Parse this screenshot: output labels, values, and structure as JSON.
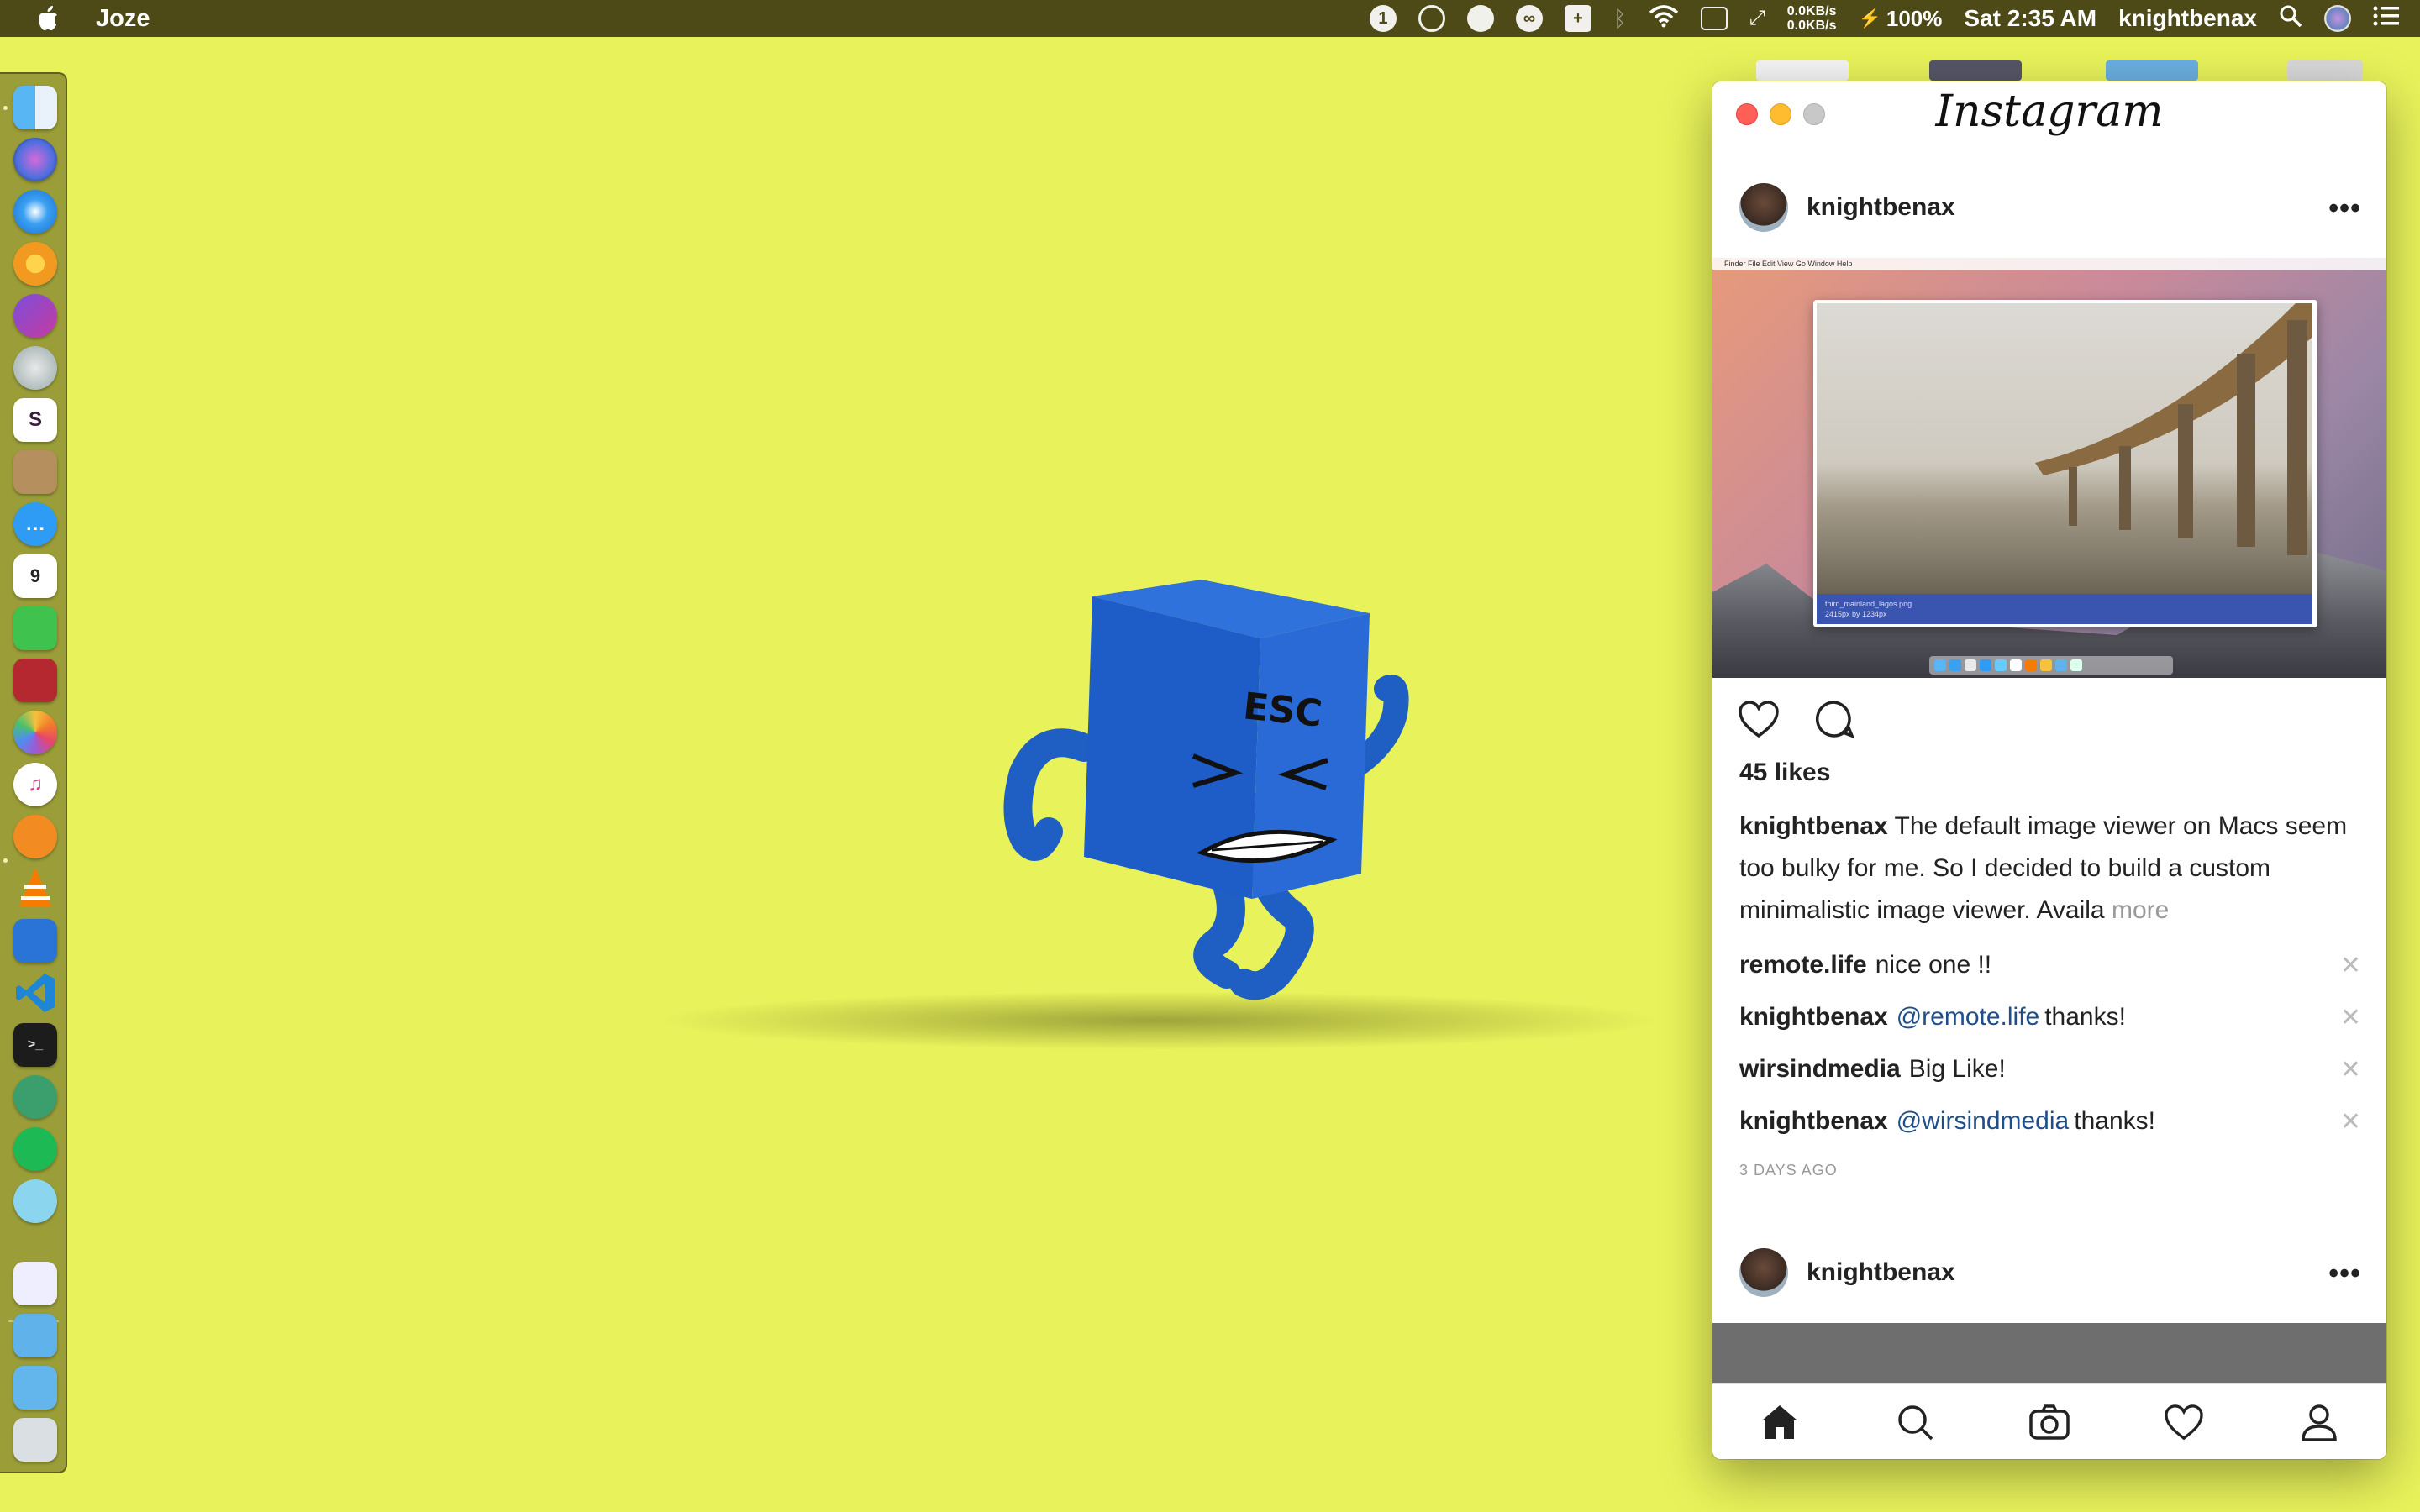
{
  "menubar": {
    "app_name": "Joze",
    "net_up": "0.0KB/s",
    "net_down": "0.0KB/s",
    "battery": "100%",
    "clock": "Sat 2:35 AM",
    "user": "knightbenax"
  },
  "instagram": {
    "logo": "Instagram",
    "post": {
      "username": "knightbenax",
      "more_label": "•••",
      "screenshot": {
        "menu": "Finder   File   Edit   View   Go   Window   Help",
        "info_line1": "third_mainland_lagos.png",
        "info_line2": "2415px by 1234px"
      },
      "likes": "45 likes",
      "caption_user": "knightbenax",
      "caption_text": "The default image viewer on Macs seem too bulky for me. So I decided to build a custom minimalistic image viewer. Availa",
      "caption_more": "more",
      "comments": [
        {
          "user": "remote.life",
          "mention": "",
          "text": "nice one !!"
        },
        {
          "user": "knightbenax",
          "mention": "@remote.life",
          "text": "thanks!"
        },
        {
          "user": "wirsindmedia",
          "mention": "",
          "text": "Big Like!"
        },
        {
          "user": "knightbenax",
          "mention": "@wirsindmedia",
          "text": "thanks!"
        }
      ],
      "remove_label": "✕",
      "time_ago": "3 DAYS AGO"
    },
    "next_post": {
      "username": "knightbenax",
      "more_label": "•••"
    }
  },
  "mascot": {
    "key_label": "ESC"
  }
}
